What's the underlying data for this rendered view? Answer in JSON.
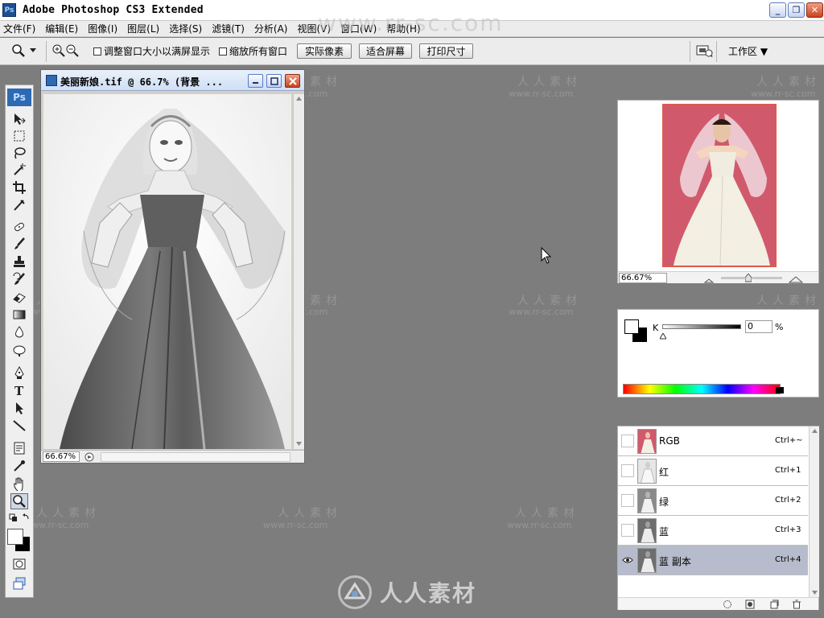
{
  "window": {
    "app_logo_text": "Ps",
    "title": "Adobe Photoshop CS3 Extended",
    "controls": [
      "_",
      "❐",
      "✕"
    ]
  },
  "menu": {
    "items": [
      "文件(F)",
      "编辑(E)",
      "图像(I)",
      "图层(L)",
      "选择(S)",
      "滤镜(T)",
      "分析(A)",
      "视图(V)",
      "窗口(W)",
      "帮助(H)"
    ]
  },
  "options": {
    "checkbox_resize": "调整窗口大小以满屏显示",
    "checkbox_zoom_all": "缩放所有窗口",
    "btn_actual_pixels": "实际像素",
    "btn_fit_screen": "适合屏幕",
    "btn_print_size": "打印尺寸",
    "workspace_label": "工作区 ▼"
  },
  "toolbox": {
    "logo_text": "Ps"
  },
  "document": {
    "title": "美丽新娘.tif @ 66.7% (背景 ...",
    "zoom": "66.67%"
  },
  "navigator": {
    "zoom": "66.67%"
  },
  "color": {
    "channel_label": "K",
    "value": "0",
    "unit": "%",
    "foreground_color": "#ffffff",
    "background_color": "#000000"
  },
  "channels": [
    {
      "name": "RGB",
      "shortcut": "Ctrl+~",
      "visible": false,
      "selected": false,
      "thumb": "color"
    },
    {
      "name": "红",
      "shortcut": "Ctrl+1",
      "visible": false,
      "selected": false,
      "thumb": "light"
    },
    {
      "name": "绿",
      "shortcut": "Ctrl+2",
      "visible": false,
      "selected": false,
      "thumb": "mid"
    },
    {
      "name": "蓝",
      "shortcut": "Ctrl+3",
      "visible": false,
      "selected": false,
      "thumb": "dark"
    },
    {
      "name": "蓝 副本",
      "shortcut": "Ctrl+4",
      "visible": true,
      "selected": true,
      "thumb": "dark"
    }
  ],
  "watermark": {
    "top_url": "www.rr-sc.com",
    "cn": "人人素材",
    "url": "www.rr-sc.com",
    "bottom_text": "人人素材"
  },
  "colors": {
    "workspace_bg": "#7d7d7d",
    "selected_channel": "#b7bccc",
    "photo_background": "#d05a6c"
  }
}
